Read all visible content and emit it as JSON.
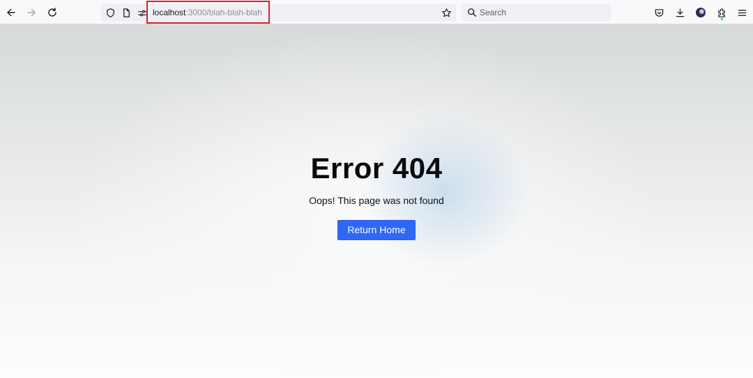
{
  "browser": {
    "nav": {
      "back_icon": "arrow-left-icon",
      "forward_icon": "arrow-right-icon",
      "reload_icon": "reload-icon"
    },
    "urlbar": {
      "tracking_icon": "shield-icon",
      "page_info_icon": "page-icon",
      "permissions_icon": "permissions-icon",
      "url_host": "localhost",
      "url_rest": ":3000/blah-blah-blah",
      "bookmark_icon": "star-icon"
    },
    "search": {
      "placeholder": "Search"
    },
    "right_icons": [
      "pocket-icon",
      "download-icon",
      "account-avatar",
      "extensions-icon",
      "menu-icon"
    ],
    "highlight_color": "#d4202a"
  },
  "page": {
    "title": "Error 404",
    "subtitle": "Oops! This page was not found",
    "button_label": "Return Home",
    "button_color": "#2f66f5"
  }
}
